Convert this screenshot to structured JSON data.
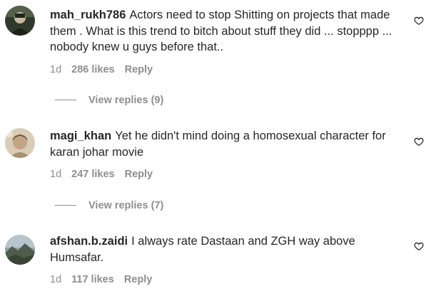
{
  "comments": [
    {
      "username": "mah_rukh786",
      "text": "Actors need to stop Shitting on projects that made them . What is this trend to bitch about stuff they did ... stopppp ... nobody knew u guys before that..",
      "time": "1d",
      "likes": "286 likes",
      "reply_label": "Reply",
      "view_replies": "View replies (9)"
    },
    {
      "username": "magi_khan",
      "text": "Yet he didn't mind doing a homosexual character for karan johar movie",
      "time": "1d",
      "likes": "247 likes",
      "reply_label": "Reply",
      "view_replies": "View replies (7)"
    },
    {
      "username": "afshan.b.zaidi",
      "text": "I always rate Dastaan and ZGH way above Humsafar.",
      "time": "1d",
      "likes": "117 likes",
      "reply_label": "Reply"
    }
  ],
  "icons": {
    "like": "heart-outline-icon",
    "avatar": "user-avatar"
  },
  "colors": {
    "text": "#262626",
    "meta": "#8e8e8e"
  }
}
